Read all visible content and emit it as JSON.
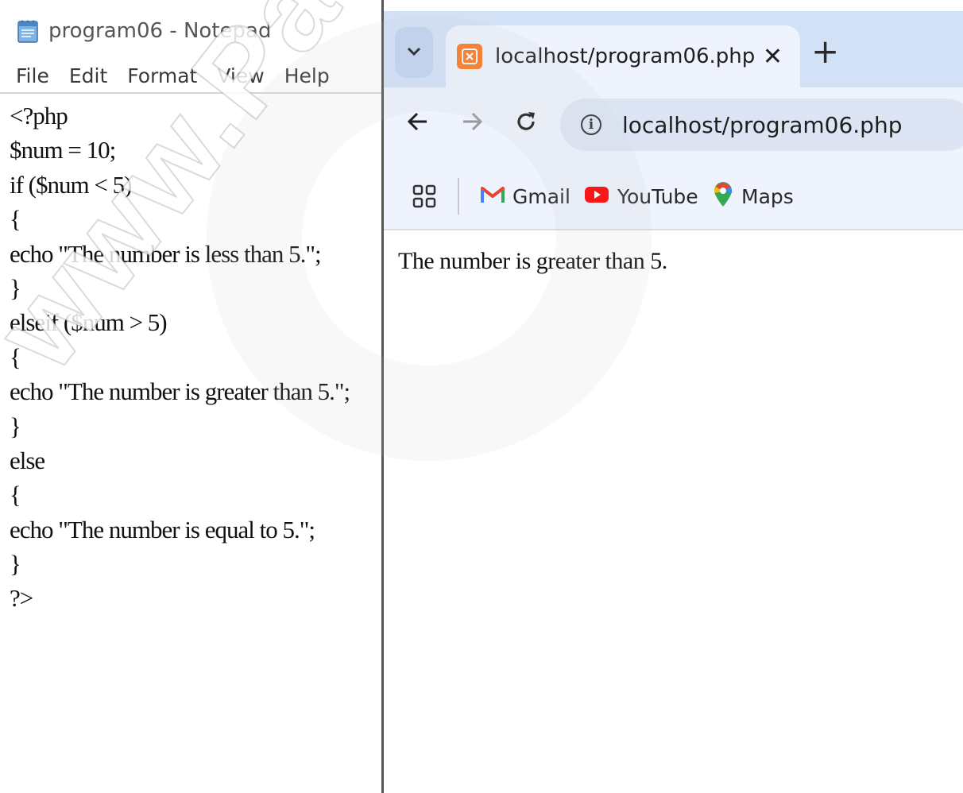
{
  "notepad": {
    "title": "program06 - Notepad",
    "menu": [
      "File",
      "Edit",
      "Format",
      "View",
      "Help"
    ],
    "code": [
      "<?php",
      "$num = 10;",
      "if ($num < 5)",
      "{",
      "echo \"The number is less than 5.\";",
      "}",
      "elseif ($num > 5)",
      "{",
      "echo \"The number is greater than 5.\";",
      "}",
      "else",
      "{",
      "echo \"The number is equal to 5.\";",
      "}",
      "?>"
    ]
  },
  "browser": {
    "tab_title": "localhost/program06.php",
    "url": "localhost/program06.php",
    "bookmarks": [
      "Gmail",
      "YouTube",
      "Maps"
    ],
    "content": "The number is greater than 5."
  },
  "watermark": "www.Padasalai"
}
